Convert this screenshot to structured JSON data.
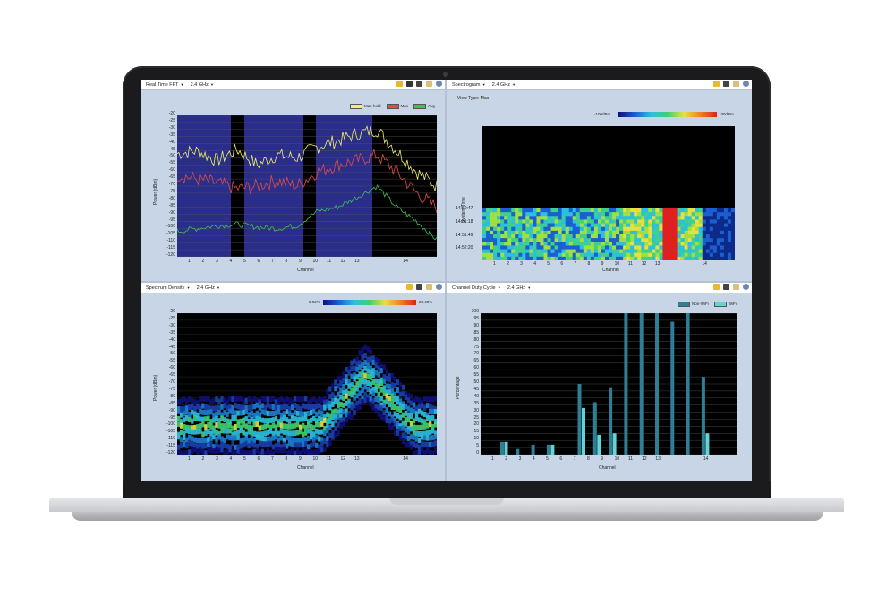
{
  "panels": {
    "fft": {
      "title": "Real Time FFT",
      "band": "2.4 GHz",
      "ylabel": "Power (dBm)",
      "xlabel": "Channel",
      "legend": [
        "Max-hold",
        "Max",
        "Avg"
      ]
    },
    "spectrogram": {
      "title": "Spectrogram",
      "band": "2.4 GHz",
      "view_type": "View Type: Max",
      "scale_min": "-100dBm",
      "scale_max": "-30dBm",
      "ylabel": "System Time",
      "xlabel": "Channel",
      "times": [
        "14:50:47",
        "14:51:18",
        "14:51:49",
        "14:52:20"
      ]
    },
    "density": {
      "title": "Spectrum Density",
      "band": "2.4 GHz",
      "scale_min": "0.92%",
      "scale_max": "20.48%",
      "ylabel": "Power (dBm)",
      "xlabel": "Channel"
    },
    "duty": {
      "title": "Channel Duty Cycle",
      "band": "2.4 GHz",
      "ylabel": "Percentage",
      "xlabel": "Channel",
      "legend": [
        "Non-WiFi",
        "WiFi"
      ]
    }
  },
  "power_ticks": [
    "-20",
    "-25",
    "-30",
    "-35",
    "-40",
    "-45",
    "-50",
    "-55",
    "-60",
    "-65",
    "-70",
    "-75",
    "-80",
    "-85",
    "-90",
    "-95",
    "-100",
    "-105",
    "-110",
    "-115",
    "-120"
  ],
  "channel_ticks": [
    "1",
    "2",
    "3",
    "4",
    "5",
    "6",
    "7",
    "8",
    "9",
    "10",
    "11",
    "12",
    "13",
    "14"
  ],
  "duty_ticks": [
    "100",
    "95",
    "90",
    "85",
    "80",
    "75",
    "70",
    "65",
    "60",
    "55",
    "50",
    "45",
    "40",
    "35",
    "30",
    "25",
    "20",
    "15",
    "10",
    "5",
    "0"
  ],
  "chart_data": [
    {
      "type": "line",
      "title": "Real Time FFT",
      "xlabel": "Channel",
      "ylabel": "Power (dBm)",
      "ylim": [
        -120,
        -20
      ],
      "series": [
        {
          "name": "Max-hold",
          "values": [
            -47,
            -45,
            -52,
            -44,
            -55,
            -48,
            -50,
            -42,
            -38,
            -33,
            -30,
            -45,
            -60,
            -70
          ]
        },
        {
          "name": "Max",
          "values": [
            -62,
            -65,
            -68,
            -72,
            -70,
            -66,
            -70,
            -60,
            -55,
            -52,
            -48,
            -60,
            -75,
            -85
          ]
        },
        {
          "name": "Avg",
          "values": [
            -102,
            -100,
            -98,
            -97,
            -99,
            -100,
            -98,
            -88,
            -85,
            -78,
            -70,
            -85,
            -95,
            -108
          ]
        }
      ]
    },
    {
      "type": "bar",
      "title": "Channel Duty Cycle",
      "xlabel": "Channel",
      "ylabel": "Percentage",
      "ylim": [
        0,
        100
      ],
      "categories": [
        "1",
        "2",
        "3",
        "4",
        "5",
        "6",
        "7",
        "8",
        "9",
        "10",
        "11",
        "12",
        "13",
        "14"
      ],
      "series": [
        {
          "name": "Non-WiFi",
          "values": [
            9,
            4,
            7,
            7,
            0,
            50,
            37,
            47,
            100,
            100,
            100,
            94,
            100,
            55
          ]
        },
        {
          "name": "WiFi",
          "values": [
            9,
            0,
            0,
            7,
            0,
            33,
            14,
            15,
            0,
            0,
            0,
            0,
            0,
            15
          ]
        }
      ]
    }
  ]
}
